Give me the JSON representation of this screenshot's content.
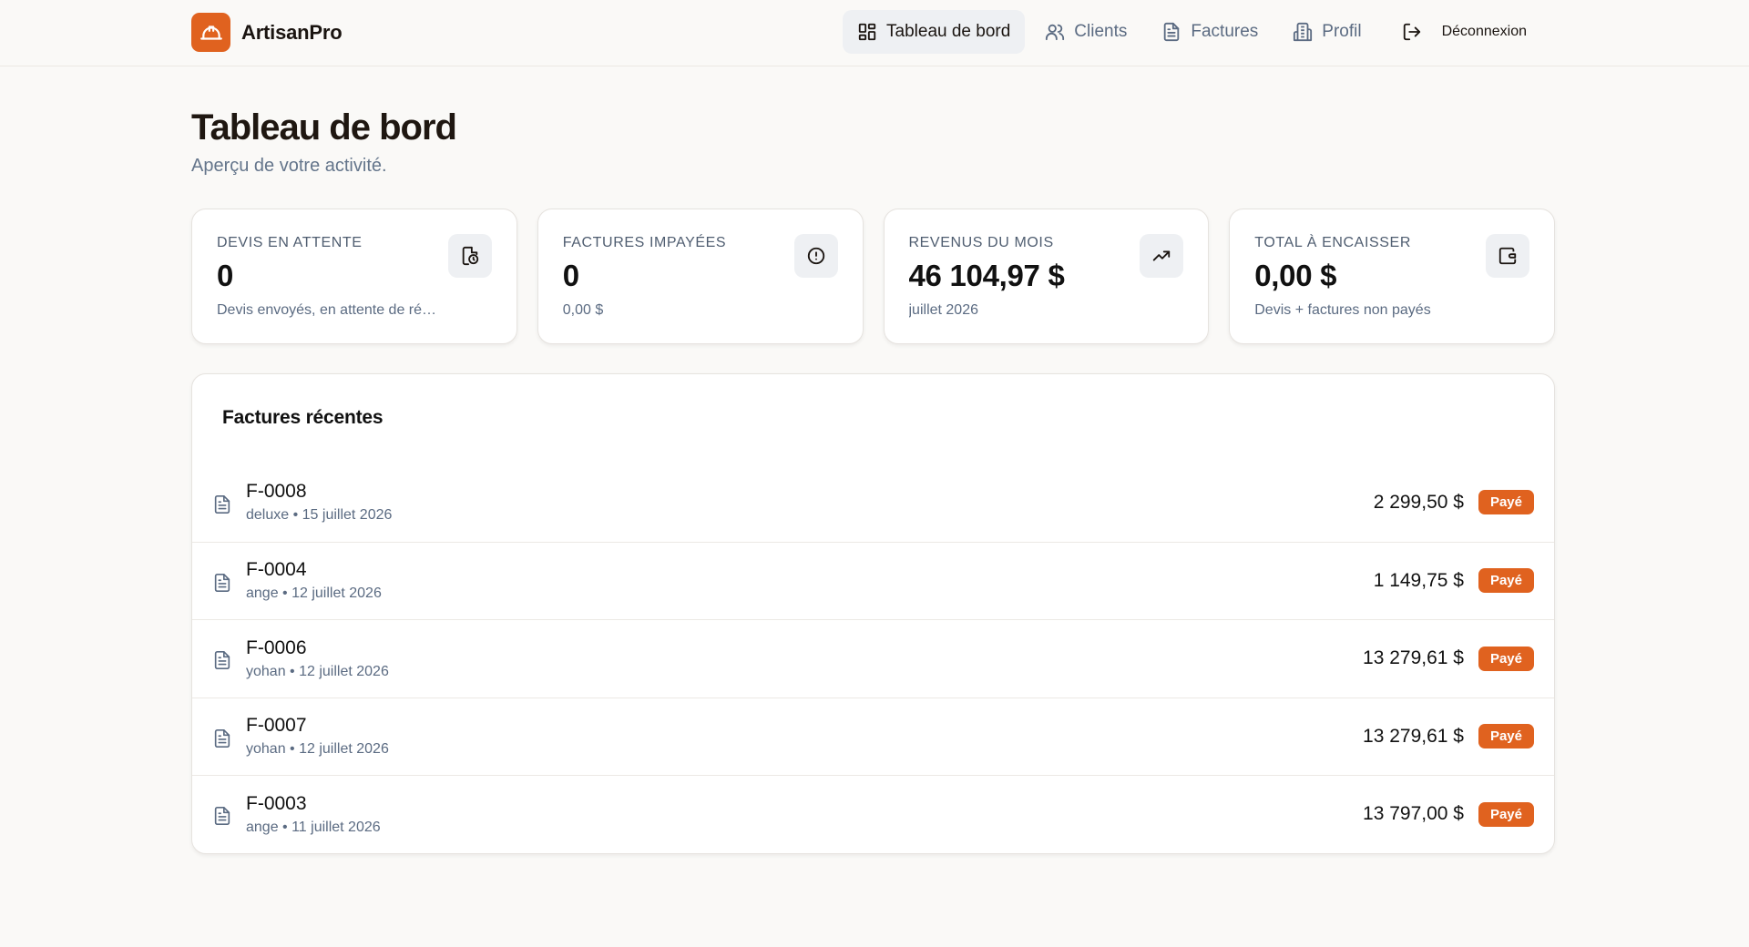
{
  "app": {
    "name": "ArtisanPro",
    "accent": "#e0621f"
  },
  "nav": {
    "items": [
      {
        "label": "Tableau de bord",
        "icon": "dashboard-grid-icon",
        "active": true
      },
      {
        "label": "Clients",
        "icon": "users-icon",
        "active": false
      },
      {
        "label": "Factures",
        "icon": "file-text-icon",
        "active": false
      },
      {
        "label": "Profil",
        "icon": "building-icon",
        "active": false
      }
    ],
    "logout_label": "Déconnexion"
  },
  "page": {
    "title": "Tableau de bord",
    "subtitle": "Aperçu de votre activité."
  },
  "stats": [
    {
      "label": "Devis en attente",
      "value": "0",
      "sub": "Devis envoyés, en attente de réponse",
      "icon": "clock-file-icon"
    },
    {
      "label": "Factures impayées",
      "value": "0",
      "sub": "0,00 $",
      "icon": "alert-circle-icon"
    },
    {
      "label": "Revenus du mois",
      "value": "46 104,97 $",
      "sub": "juillet 2026",
      "icon": "trending-up-icon"
    },
    {
      "label": "Total à encaisser",
      "value": "0,00 $",
      "sub": "Devis + factures non payés",
      "icon": "wallet-icon"
    }
  ],
  "recent_invoices": {
    "title": "Factures récentes",
    "rows": [
      {
        "number": "F-0008",
        "client": "deluxe",
        "date": "15 juillet 2026",
        "amount": "2 299,50 $",
        "status": "Payé"
      },
      {
        "number": "F-0004",
        "client": "ange",
        "date": "12 juillet 2026",
        "amount": "1 149,75 $",
        "status": "Payé"
      },
      {
        "number": "F-0006",
        "client": "yohan",
        "date": "12 juillet 2026",
        "amount": "13 279,61 $",
        "status": "Payé"
      },
      {
        "number": "F-0007",
        "client": "yohan",
        "date": "12 juillet 2026",
        "amount": "13 279,61 $",
        "status": "Payé"
      },
      {
        "number": "F-0003",
        "client": "ange",
        "date": "11 juillet 2026",
        "amount": "13 797,00 $",
        "status": "Payé"
      }
    ]
  }
}
